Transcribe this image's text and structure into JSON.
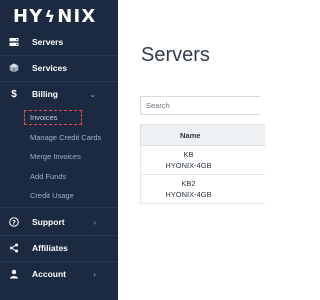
{
  "brand": {
    "logo_left": "HY",
    "logo_mid": "ϟ",
    "logo_right": "NIX"
  },
  "sidebar": {
    "items": [
      {
        "label": "Servers",
        "icon": "server-icon"
      },
      {
        "label": "Services",
        "icon": "cube-icon"
      },
      {
        "label": "Billing",
        "icon": "dollar-icon",
        "expanded": true
      },
      {
        "label": "Support",
        "icon": "question-circle-icon"
      },
      {
        "label": "Affiliates",
        "icon": "share-icon"
      },
      {
        "label": "Account",
        "icon": "user-icon"
      }
    ],
    "billing_sub": [
      "Invoices",
      "Manage Credit Cards",
      "Merge Invoices",
      "Add Funds",
      "Credit Usage"
    ],
    "active_sub": "Invoices"
  },
  "main": {
    "title": "Servers",
    "search": {
      "placeholder": "Search"
    },
    "table": {
      "header": "Name",
      "rows": [
        {
          "line1": "KB",
          "line2": "HYONIX-4GB"
        },
        {
          "line1": "KB2",
          "line2": "HYONIX-4GB"
        }
      ]
    }
  },
  "colors": {
    "sidebar_bg": "#1b2a41",
    "highlight_border": "#d9534f"
  }
}
